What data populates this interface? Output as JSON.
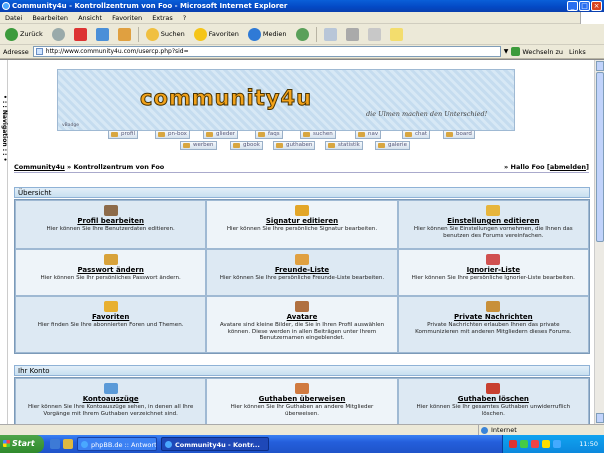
{
  "window": {
    "title": "Community4u - Kontrollzentrum von Foo - Microsoft Internet Explorer"
  },
  "menu": [
    "Datei",
    "Bearbeiten",
    "Ansicht",
    "Favoriten",
    "Extras",
    "?"
  ],
  "toolbar": {
    "back": "Zurück",
    "search": "Suchen",
    "favorites": "Favoriten",
    "media": "Medien"
  },
  "address": {
    "label": "Adresse",
    "url": "http://www.community4u.com/usercp.php?sid=",
    "go": "Wechseln zu",
    "links": "Links"
  },
  "sidenav": {
    "text": "• : : Navigation : : •"
  },
  "banner": {
    "logo": "community4u",
    "slogan": "die Ulmen machen den Unterschied!",
    "version": "vBadge"
  },
  "nav_buttons": {
    "row1": [
      "profil",
      "pn-box",
      "glieder",
      "faqs",
      "suchen",
      "nav",
      "chat",
      "board"
    ],
    "row2": [
      "werben",
      "gbook",
      "guthaben",
      "statistik",
      "galerie"
    ]
  },
  "breadcrumb": {
    "site": "Community4u",
    "sep": " » ",
    "page": "Kontrollzentrum von Foo",
    "greeting_prefix": "» Hallo Foo [",
    "logout": "abmelden",
    "greeting_suffix": "]"
  },
  "sections": {
    "overview": {
      "title": "Übersicht",
      "cells": [
        {
          "title": "Profil bearbeiten",
          "desc": "Hier können Sie Ihre Benutzerdaten editieren."
        },
        {
          "title": "Signatur editieren",
          "desc": "Hier können Sie Ihre persönliche Signatur bearbeiten."
        },
        {
          "title": "Einstellungen editieren",
          "desc": "Hier können Sie Einstellungen vornehmen, die Ihnen das benutzen des Forums vereinfachen."
        },
        {
          "title": "Passwort ändern",
          "desc": "Hier können Sie Ihr persönliches Passwort ändern."
        },
        {
          "title": "Freunde-Liste",
          "desc": "Hier können Sie Ihre persönliche Freunde-Liste bearbeiten."
        },
        {
          "title": "Ignorier-Liste",
          "desc": "Hier können Sie Ihre persönliche Ignorier-Liste bearbeiten."
        },
        {
          "title": "Favoriten",
          "desc": "Hier finden Sie Ihre abonnierten Foren und Themen."
        },
        {
          "title": "Avatare",
          "desc": "Avatare sind kleine Bilder, die Sie in Ihren Profil auswählen können. Diese werden in allen Beiträgen unter Ihrem Benutzernamen eingeblendet."
        },
        {
          "title": "Private Nachrichten",
          "desc": "Private Nachrichten erlauben Ihnen das private Kommunizieren mit anderen Mitgliedern dieses Forums."
        }
      ]
    },
    "account": {
      "title": "Ihr Konto",
      "cells": [
        {
          "title": "Kontoauszüge",
          "desc": "Hier können Sie Ihre Kontoauszüge sehen, in denen all Ihre Vorgänge mit Ihrem Guthaben verzeichnet sind."
        },
        {
          "title": "Guthaben überweisen",
          "desc": "Hier können Sie Ihr Guthaben an andere Mitglieder überweisen."
        },
        {
          "title": "Guthaben löschen",
          "desc": "Hier können Sie Ihr gesamtes Guthaben unwiderruflich löschen."
        }
      ]
    }
  },
  "status": {
    "zone": "Internet"
  },
  "taskbar": {
    "start": "Start",
    "task1": "phpBB.de :: Antwort sch...",
    "task2": "Community4u - Kontr...",
    "clock": "11:50"
  },
  "colors": {
    "title_bar": "#0348c4",
    "cell_dark": "#dde9f3",
    "cell_light": "#eef4f9",
    "logo": "#f2a21a",
    "taskbar": "#245edb"
  }
}
